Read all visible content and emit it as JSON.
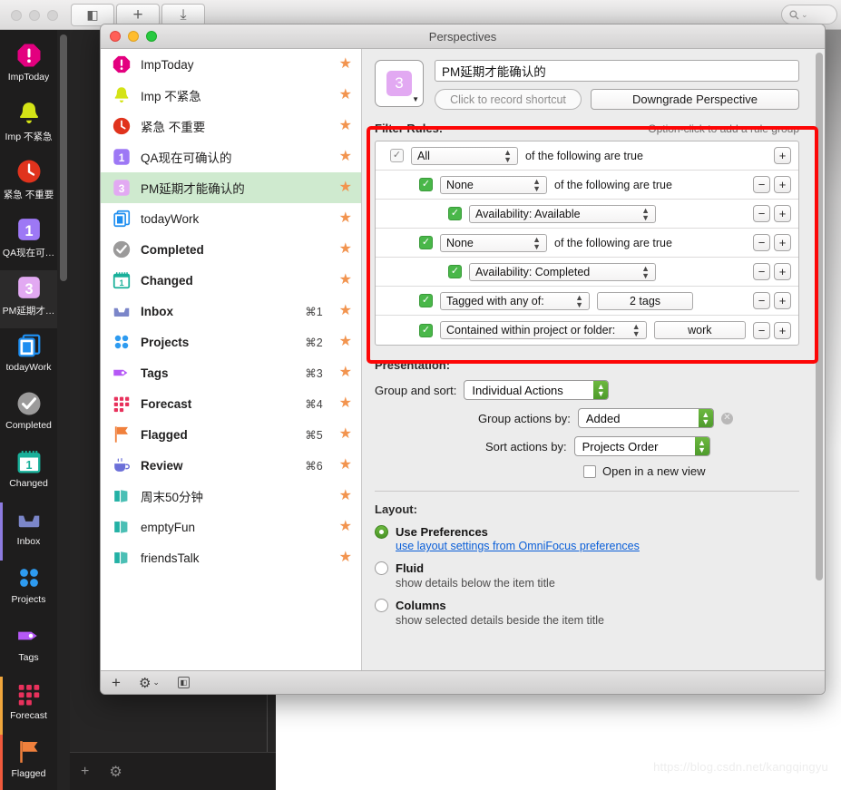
{
  "app": {
    "toolbar": {
      "sidebar_toggle": "◧",
      "add": "+",
      "inbox_download": "⤓",
      "search_placeholder": "Q"
    },
    "watermark": "https://blog.csdn.net/kangqingyu",
    "dark_footer": {
      "add": "+",
      "gear": "⚙"
    }
  },
  "rail": [
    {
      "label": "ImpToday",
      "icon": "exclamation-octagon-icon",
      "color": "#e3007f",
      "selected": false,
      "accent": ""
    },
    {
      "label": "Imp 不紧急",
      "icon": "bell-icon",
      "color": "#d4e316",
      "selected": false,
      "accent": ""
    },
    {
      "label": "紧急 不重要",
      "icon": "clock-icon",
      "color": "#e0331d",
      "selected": false,
      "accent": ""
    },
    {
      "label": "QA现在可…",
      "icon": "number-badge-1-icon",
      "color": "#9d78f5",
      "selected": false,
      "accent": ""
    },
    {
      "label": "PM延期才…",
      "icon": "number-badge-3-icon",
      "color": "#e2a9f2",
      "selected": true,
      "accent": ""
    },
    {
      "label": "todayWork",
      "icon": "stacked-pages-icon",
      "color": "#1e8ef0",
      "selected": false,
      "accent": ""
    },
    {
      "label": "Completed",
      "icon": "check-circle-icon",
      "color": "#9b9a9a",
      "selected": false,
      "accent": ""
    },
    {
      "label": "Changed",
      "icon": "calendar-icon",
      "color": "#19b09a",
      "selected": false,
      "accent": ""
    },
    {
      "label": "Inbox",
      "icon": "inbox-tray-icon",
      "color": "#7b86c9",
      "selected": false,
      "accent": "#8d7be0"
    },
    {
      "label": "Projects",
      "icon": "projects-dots-icon",
      "color": "#2e9bf0",
      "selected": false,
      "accent": ""
    },
    {
      "label": "Tags",
      "icon": "tag-icon",
      "color": "#b558f6",
      "selected": false,
      "accent": ""
    },
    {
      "label": "Forecast",
      "icon": "forecast-grid-icon",
      "color": "#e8315c",
      "selected": false,
      "accent": "#f0a63c"
    },
    {
      "label": "Flagged",
      "icon": "flag-icon",
      "color": "#f0803c",
      "selected": false,
      "accent": "#f05a3c"
    }
  ],
  "dialog": {
    "title": "Perspectives",
    "traffic": {
      "close": "close-button",
      "minimize": "minimize-button",
      "zoom": "zoom-button"
    },
    "perspectives": [
      {
        "name": "ImpToday",
        "icon": "exclamation-octagon-icon",
        "color": "#e3007f",
        "shortcut": "",
        "starred": true,
        "bold": false,
        "selected": false
      },
      {
        "name": "Imp 不紧急",
        "icon": "bell-icon",
        "color": "#d4e316",
        "shortcut": "",
        "starred": true,
        "bold": false,
        "selected": false
      },
      {
        "name": "紧急 不重要",
        "icon": "clock-icon",
        "color": "#e0331d",
        "shortcut": "",
        "starred": true,
        "bold": false,
        "selected": false
      },
      {
        "name": "QA现在可确认的",
        "icon": "number-badge-1-icon",
        "color": "#9d78f5",
        "shortcut": "",
        "starred": true,
        "bold": false,
        "selected": false
      },
      {
        "name": "PM延期才能确认的",
        "icon": "number-badge-3-icon",
        "color": "#e2a9f2",
        "shortcut": "",
        "starred": true,
        "bold": false,
        "selected": true
      },
      {
        "name": "todayWork",
        "icon": "stacked-pages-icon",
        "color": "#1e8ef0",
        "shortcut": "",
        "starred": true,
        "bold": false,
        "selected": false
      },
      {
        "name": "Completed",
        "icon": "check-circle-icon",
        "color": "#9b9a9a",
        "shortcut": "",
        "starred": true,
        "bold": true,
        "selected": false
      },
      {
        "name": "Changed",
        "icon": "calendar-icon",
        "color": "#19b09a",
        "shortcut": "",
        "starred": true,
        "bold": true,
        "selected": false
      },
      {
        "name": "Inbox",
        "icon": "inbox-tray-icon",
        "color": "#7b86c9",
        "shortcut": "⌘1",
        "starred": true,
        "bold": true,
        "selected": false
      },
      {
        "name": "Projects",
        "icon": "projects-dots-icon",
        "color": "#2e9bf0",
        "shortcut": "⌘2",
        "starred": true,
        "bold": true,
        "selected": false
      },
      {
        "name": "Tags",
        "icon": "tag-icon",
        "color": "#b558f6",
        "shortcut": "⌘3",
        "starred": true,
        "bold": true,
        "selected": false
      },
      {
        "name": "Forecast",
        "icon": "forecast-grid-icon",
        "color": "#e8315c",
        "shortcut": "⌘4",
        "starred": true,
        "bold": true,
        "selected": false
      },
      {
        "name": "Flagged",
        "icon": "flag-icon",
        "color": "#f0803c",
        "shortcut": "⌘5",
        "starred": true,
        "bold": true,
        "selected": false
      },
      {
        "name": "Review",
        "icon": "coffee-cup-icon",
        "color": "#6b6fd8",
        "shortcut": "⌘6",
        "starred": true,
        "bold": true,
        "selected": false
      },
      {
        "name": "周末50分钟",
        "icon": "folder-box-icon",
        "color": "#23b1a5",
        "shortcut": "",
        "starred": true,
        "bold": false,
        "selected": false
      },
      {
        "name": "emptyFun",
        "icon": "folder-box-icon",
        "color": "#23b1a5",
        "shortcut": "",
        "starred": true,
        "bold": false,
        "selected": false
      },
      {
        "name": "friendsTalk",
        "icon": "folder-box-icon",
        "color": "#23b1a5",
        "shortcut": "",
        "starred": true,
        "bold": false,
        "selected": false
      }
    ],
    "detail": {
      "icon_badge": "3",
      "name_value": "PM延期才能确认的",
      "shortcut_placeholder": "Click to record shortcut",
      "downgrade_label": "Downgrade Perspective",
      "filter": {
        "title": "Filter Rules:",
        "hint": "Option-click to add a rule group",
        "rules": [
          {
            "indent": 0,
            "checked": "grey",
            "popup": "All",
            "suffix": "of the following are true",
            "value": "",
            "minus": false,
            "plus": true
          },
          {
            "indent": 1,
            "checked": "green",
            "popup": "None",
            "suffix": "of the following are true",
            "value": "",
            "minus": true,
            "plus": true
          },
          {
            "indent": 2,
            "checked": "green",
            "popup": "Availability: Available",
            "suffix": "",
            "value": "",
            "minus": true,
            "plus": true
          },
          {
            "indent": 1,
            "checked": "green",
            "popup": "None",
            "suffix": "of the following are true",
            "value": "",
            "minus": true,
            "plus": true
          },
          {
            "indent": 2,
            "checked": "green",
            "popup": "Availability: Completed",
            "suffix": "",
            "value": "",
            "minus": true,
            "plus": true
          },
          {
            "indent": 1,
            "checked": "green",
            "popup": "Tagged with any of:",
            "suffix": "",
            "value": "2 tags",
            "minus": true,
            "plus": true
          },
          {
            "indent": 1,
            "checked": "green",
            "popup": "Contained within project or folder:",
            "suffix": "",
            "value": "work",
            "minus": true,
            "plus": true
          }
        ],
        "minus_glyph": "−",
        "plus_glyph": "+"
      },
      "presentation": {
        "title": "Presentation:",
        "group_and_sort_label": "Group and sort:",
        "group_and_sort_value": "Individual Actions",
        "group_actions_label": "Group actions by:",
        "group_actions_value": "Added",
        "sort_actions_label": "Sort actions by:",
        "sort_actions_value": "Projects Order",
        "open_new_view_label": "Open in a new view",
        "open_new_view_checked": false,
        "clear_glyph": "✕"
      },
      "layout": {
        "title": "Layout:",
        "options": [
          {
            "label": "Use Preferences",
            "sub": "use layout settings from OmniFocus preferences",
            "sub_is_link": true,
            "selected": true
          },
          {
            "label": "Fluid",
            "sub": "show details below the item title",
            "sub_is_link": false,
            "selected": false
          },
          {
            "label": "Columns",
            "sub": "show selected details beside the item title",
            "sub_is_link": false,
            "selected": false
          }
        ]
      }
    },
    "footer": {
      "add": "+",
      "gear": "⚙",
      "chevron": "⌄",
      "panel": "◧"
    }
  }
}
